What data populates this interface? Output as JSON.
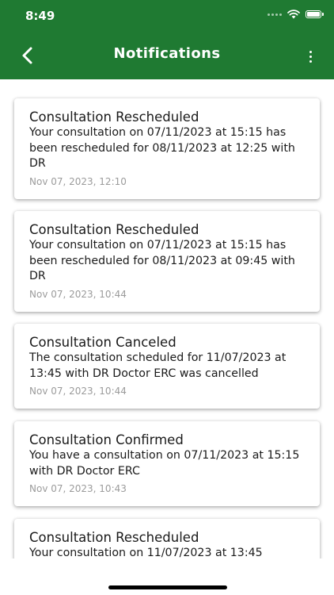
{
  "status": {
    "time": "8:49"
  },
  "header": {
    "title": "Notifications"
  },
  "notifications": [
    {
      "title": "Consultation Rescheduled",
      "body": "Your consultation on 07/11/2023 at 15:15 has been rescheduled for 08/11/2023 at 12:25 with DR",
      "time": "Nov 07, 2023, 12:10"
    },
    {
      "title": "Consultation Rescheduled",
      "body": "Your consultation on 07/11/2023 at 15:15 has been rescheduled for 08/11/2023 at 09:45 with DR",
      "time": "Nov 07, 2023, 10:44"
    },
    {
      "title": "Consultation Canceled",
      "body": "The consultation scheduled for 11/07/2023 at 13:45 with DR Doctor ERC was cancelled",
      "time": "Nov 07, 2023, 10:44"
    },
    {
      "title": "Consultation Confirmed",
      "body": "You have a consultation on 07/11/2023 at 15:15 with DR Doctor ERC",
      "time": "Nov 07, 2023, 10:43"
    },
    {
      "title": "Consultation Rescheduled",
      "body": "Your consultation on 11/07/2023 at 13:45",
      "time": ""
    }
  ],
  "colors": {
    "header_bg": "#1f7a32",
    "time_text": "#9b9b9b"
  },
  "icons": {
    "back": "chevron-left-icon",
    "menu": "more-vertical-icon",
    "wifi": "wifi-icon",
    "battery": "battery-icon",
    "signal": "signal-dots-icon"
  }
}
